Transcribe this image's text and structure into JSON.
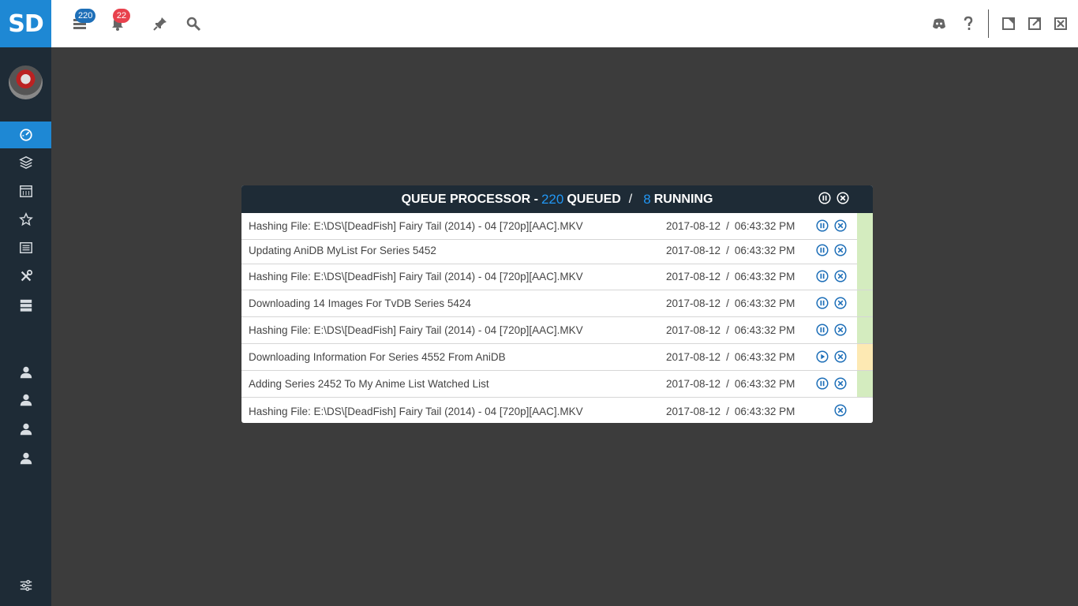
{
  "app": {
    "logo": "SD"
  },
  "topbar": {
    "queue_badge": "220",
    "notif_badge": "22",
    "icons_left": [
      "queue-icon",
      "bell-icon",
      "pin-icon",
      "search-icon"
    ],
    "icons_right": [
      "discord-icon",
      "help-icon",
      "minimize-icon",
      "maximize-icon",
      "close-icon"
    ]
  },
  "sidebar": {
    "items": [
      "dashboard-icon",
      "collection-icon",
      "calendar-icon",
      "star-icon",
      "list-icon",
      "tools-icon",
      "server-icon"
    ],
    "users": [
      "user-icon",
      "user-icon",
      "user-icon",
      "user-icon"
    ],
    "bottom": "settings-sliders-icon"
  },
  "modal": {
    "title_prefix": "QUEUE PROCESSOR -",
    "queued_count": "220",
    "queued_label": "QUEUED",
    "slash": "/",
    "running_count": "8",
    "running_label": "RUNNING",
    "rows": [
      {
        "desc": "Hashing File: E:\\DS\\[DeadFish] Fairy Tail (2014) - 04 [720p][AAC].MKV",
        "date": "2017-08-12",
        "time": "06:43:32 PM",
        "action": "pause",
        "status": "#d4ecbf"
      },
      {
        "desc": "Updating AniDB MyList For Series 5452",
        "date": "2017-08-12",
        "time": "06:43:32 PM",
        "action": "pause",
        "status": "#d4ecbf"
      },
      {
        "desc": "Hashing File: E:\\DS\\[DeadFish] Fairy Tail (2014) - 04 [720p][AAC].MKV",
        "date": "2017-08-12",
        "time": "06:43:32 PM",
        "action": "pause",
        "status": "#d4ecbf"
      },
      {
        "desc": "Downloading 14 Images For TvDB Series 5424",
        "date": "2017-08-12",
        "time": "06:43:32 PM",
        "action": "pause",
        "status": "#d4ecbf"
      },
      {
        "desc": "Hashing File: E:\\DS\\[DeadFish] Fairy Tail (2014) - 04 [720p][AAC].MKV",
        "date": "2017-08-12",
        "time": "06:43:32 PM",
        "action": "pause",
        "status": "#d4ecbf"
      },
      {
        "desc": "Downloading Information For Series 4552 From AniDB",
        "date": "2017-08-12",
        "time": "06:43:32 PM",
        "action": "play",
        "status": "#fde9b3"
      },
      {
        "desc": "Adding Series 2452 To My Anime List Watched List",
        "date": "2017-08-12",
        "time": "06:43:32 PM",
        "action": "pause",
        "status": "#d4ecbf"
      },
      {
        "desc": "Hashing File: E:\\DS\\[DeadFish] Fairy Tail (2014) - 04 [720p][AAC].MKV",
        "date": "2017-08-12",
        "time": "06:43:32 PM",
        "action": "none",
        "status": "#ffffff"
      }
    ]
  },
  "colors": {
    "accent": "#1e88d4",
    "sidebar": "#1e2b36",
    "background": "#3c3c3c",
    "icon_blue": "#1e6fb8"
  }
}
